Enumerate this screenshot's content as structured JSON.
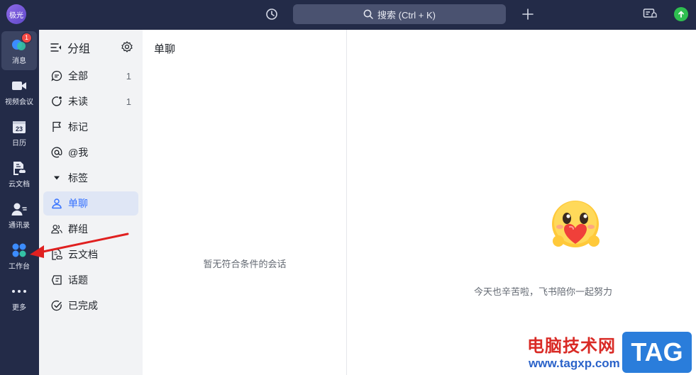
{
  "topbar": {
    "avatar_text": "极光",
    "search_placeholder": "搜索 (Ctrl + K)"
  },
  "rail": {
    "items": [
      {
        "label": "消息",
        "badge": "1"
      },
      {
        "label": "视频会议"
      },
      {
        "label": "日历",
        "date": "23"
      },
      {
        "label": "云文档"
      },
      {
        "label": "通讯录"
      },
      {
        "label": "工作台"
      },
      {
        "label": "更多"
      }
    ]
  },
  "groups": {
    "title": "分组",
    "items": [
      {
        "label": "全部",
        "count": "1"
      },
      {
        "label": "未读",
        "count": "1"
      },
      {
        "label": "标记"
      },
      {
        "label": "@我"
      },
      {
        "label": "标签"
      },
      {
        "label": "单聊"
      },
      {
        "label": "群组"
      },
      {
        "label": "云文档"
      },
      {
        "label": "话题"
      },
      {
        "label": "已完成"
      }
    ]
  },
  "chatlist": {
    "title": "单聊",
    "empty_text": "暂无符合条件的会话"
  },
  "main": {
    "tagline": "今天也辛苦啦，飞书陪你一起努力"
  },
  "watermark": {
    "site_name": "电脑技术网",
    "url": "www.tagxp.com",
    "tag": "TAG"
  },
  "colors": {
    "rail_bg": "#232b48",
    "accent": "#3370ff",
    "badge": "#f54a45",
    "arrow": "#e02020"
  }
}
